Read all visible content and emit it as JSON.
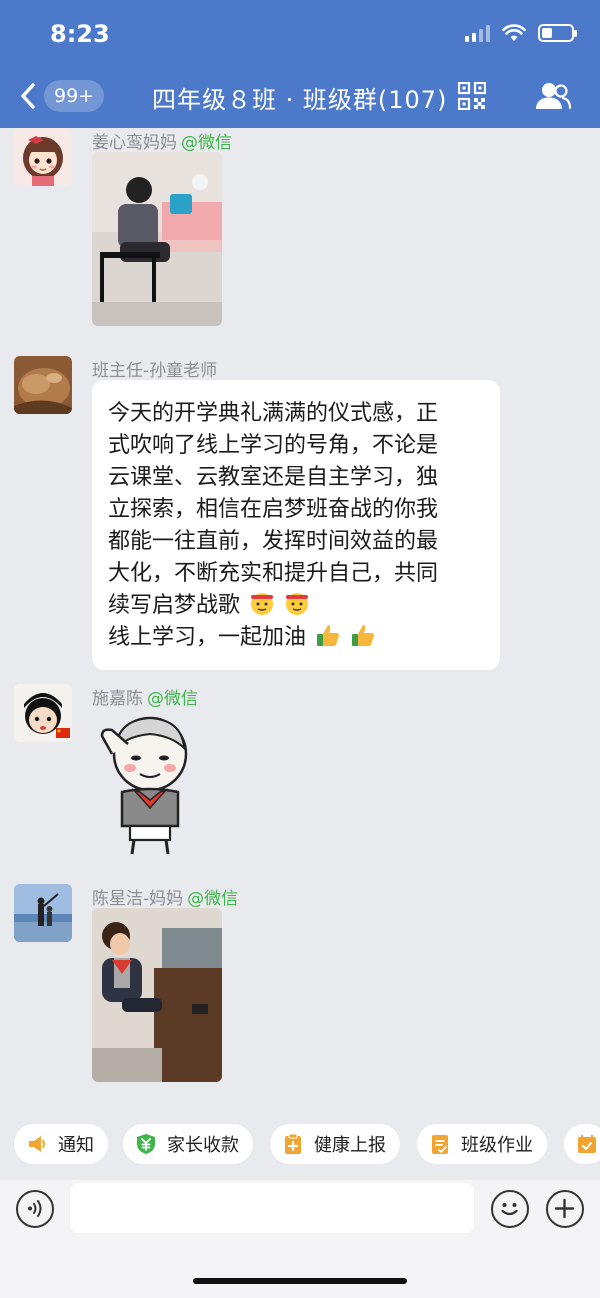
{
  "status": {
    "time": "8:23"
  },
  "nav": {
    "unread_badge": "99+",
    "title": "四年级８班 · 班级群(107)"
  },
  "messages": [
    {
      "sender": "姜心鸾妈妈",
      "via": "@微信",
      "type": "image"
    },
    {
      "sender": "班主任-孙童老师",
      "via": "",
      "type": "text",
      "lines": [
        "今天的开学典礼满满的仪式感，正",
        "式吹响了线上学习的号角，不论是",
        "云课堂、云教室还是自主学习，独",
        "立探索，相信在启梦班奋战的你我",
        "都能一往直前，发挥时间效益的最",
        "大化，不断充实和提升自己，共同",
        "续写启梦战歌",
        "线上学习，一起加油"
      ]
    },
    {
      "sender": "施嘉陈",
      "via": "@微信",
      "type": "sticker"
    },
    {
      "sender": "陈星洁-妈妈",
      "via": "@微信",
      "type": "image"
    }
  ],
  "quick_actions": [
    {
      "label": "通知",
      "icon": "megaphone-icon",
      "color": "#f2a431"
    },
    {
      "label": "家长收款",
      "icon": "yen-shield-icon",
      "color": "#3fb44a"
    },
    {
      "label": "健康上报",
      "icon": "clipboard-plus-icon",
      "color": "#f2a431"
    },
    {
      "label": "班级作业",
      "icon": "homework-icon",
      "color": "#f2a431"
    },
    {
      "label": "",
      "icon": "calendar-check-icon",
      "color": "#f2a431"
    }
  ],
  "colors": {
    "header": "#4c79c9",
    "wechat_tag": "#3fb44a",
    "background": "#e9eaee"
  }
}
